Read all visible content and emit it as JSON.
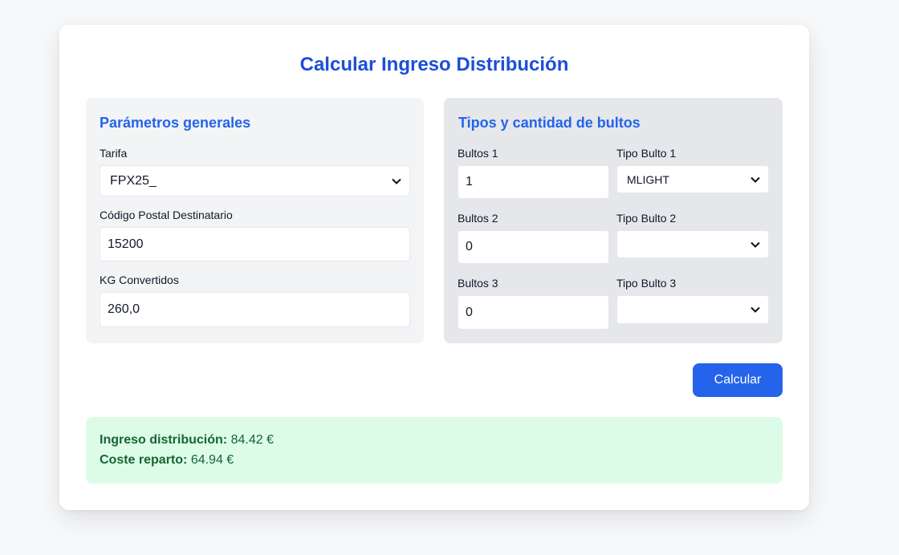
{
  "title": "Calcular Ingreso Distribución",
  "general": {
    "title": "Parámetros generales",
    "tarifa_label": "Tarifa",
    "tarifa_value": "FPX25_",
    "cp_label": "Código Postal Destinatario",
    "cp_value": "15200",
    "kg_label": "KG Convertidos",
    "kg_value": "260,0"
  },
  "bultos": {
    "title": "Tipos y cantidad de bultos",
    "rows": [
      {
        "qty_label": "Bultos 1",
        "qty_value": "1",
        "type_label": "Tipo Bulto 1",
        "type_value": "MLIGHT"
      },
      {
        "qty_label": "Bultos 2",
        "qty_value": "0",
        "type_label": "Tipo Bulto 2",
        "type_value": ""
      },
      {
        "qty_label": "Bultos 3",
        "qty_value": "0",
        "type_label": "Tipo Bulto 3",
        "type_value": ""
      }
    ]
  },
  "actions": {
    "calcular_label": "Calcular"
  },
  "result": {
    "ingreso_label": "Ingreso distribución:",
    "ingreso_value": "84.42 €",
    "coste_label": "Coste reparto:",
    "coste_value": "64.94 €"
  },
  "colors": {
    "accent": "#2563eb",
    "title": "#1d4ed8",
    "result_bg": "#dcfce7",
    "result_text": "#166534"
  }
}
